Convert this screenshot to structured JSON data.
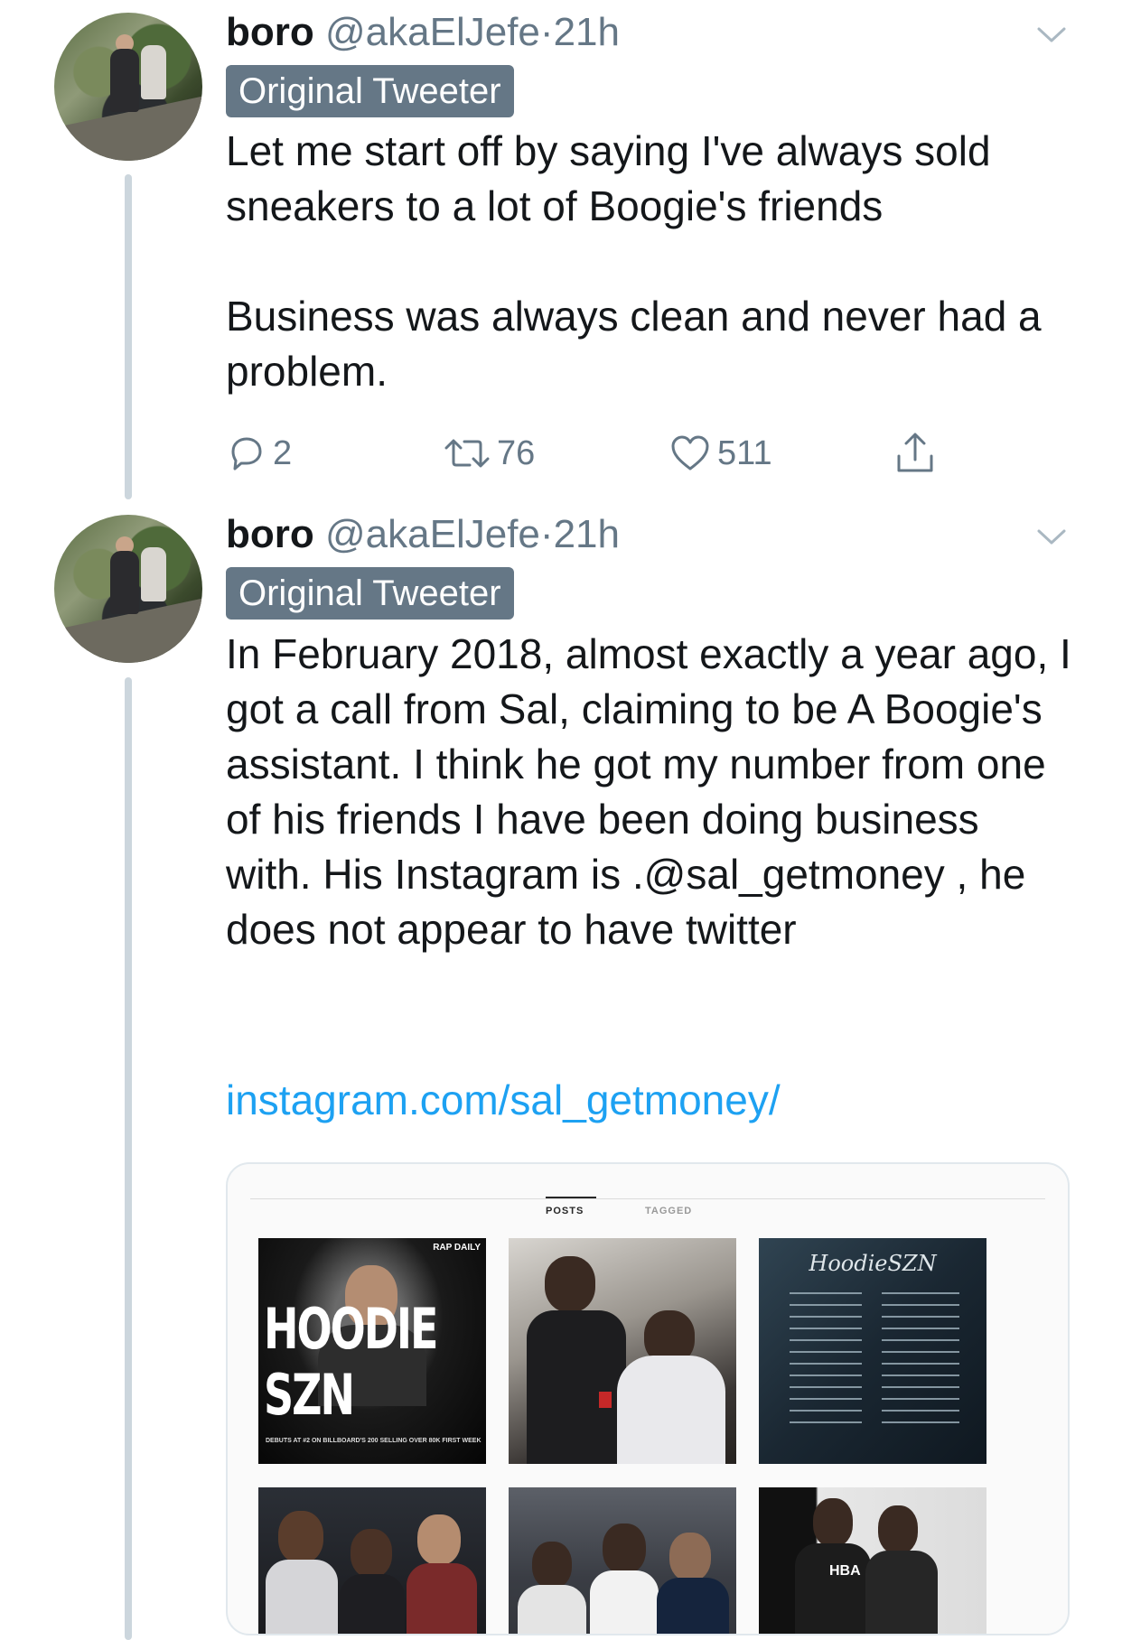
{
  "tweets": [
    {
      "author_name": "boro",
      "author_handle": "@akaElJefe",
      "separator": "·",
      "time": "21h",
      "badge": "Original Tweeter",
      "text": "Let me start off by saying I've always sold sneakers to a lot of Boogie's friends\n\nBusiness was always clean and never had a problem.",
      "stats": {
        "replies": "2",
        "retweets": "76",
        "likes": "511"
      }
    },
    {
      "author_name": "boro",
      "author_handle": "@akaElJefe",
      "separator": "·",
      "time": "21h",
      "badge": "Original Tweeter",
      "text": "In February 2018, almost exactly a year ago, I got a call from Sal, claiming to be A Boogie's assistant. I think he got my number from one of his friends I have been doing business with. His Instagram is .@sal_getmoney , he does not appear to have twitter",
      "link": "instagram.com/sal_getmoney/"
    }
  ],
  "instagram_preview": {
    "tabs": [
      "POSTS",
      "TAGGED"
    ],
    "tiles": [
      {
        "title": "HOODIE SZN",
        "subtitle": "DEBUTS AT #2 ON BILLBOARD'S 200 SELLING OVER 80K FIRST WEEK",
        "logo": "RAP\nDAILY"
      },
      {
        "title": ""
      },
      {
        "title": "HoodieSZN"
      },
      {
        "title": ""
      },
      {
        "title": ""
      },
      {
        "title": "HBA"
      }
    ]
  },
  "icons": {
    "reply": "reply-icon",
    "retweet": "retweet-icon",
    "like": "heart-icon",
    "share": "share-icon",
    "menu": "chevron-down-icon"
  },
  "colors": {
    "link": "#1da1f2",
    "muted": "#657786",
    "badge": "#657786",
    "thread_line": "#ccd6dd"
  }
}
